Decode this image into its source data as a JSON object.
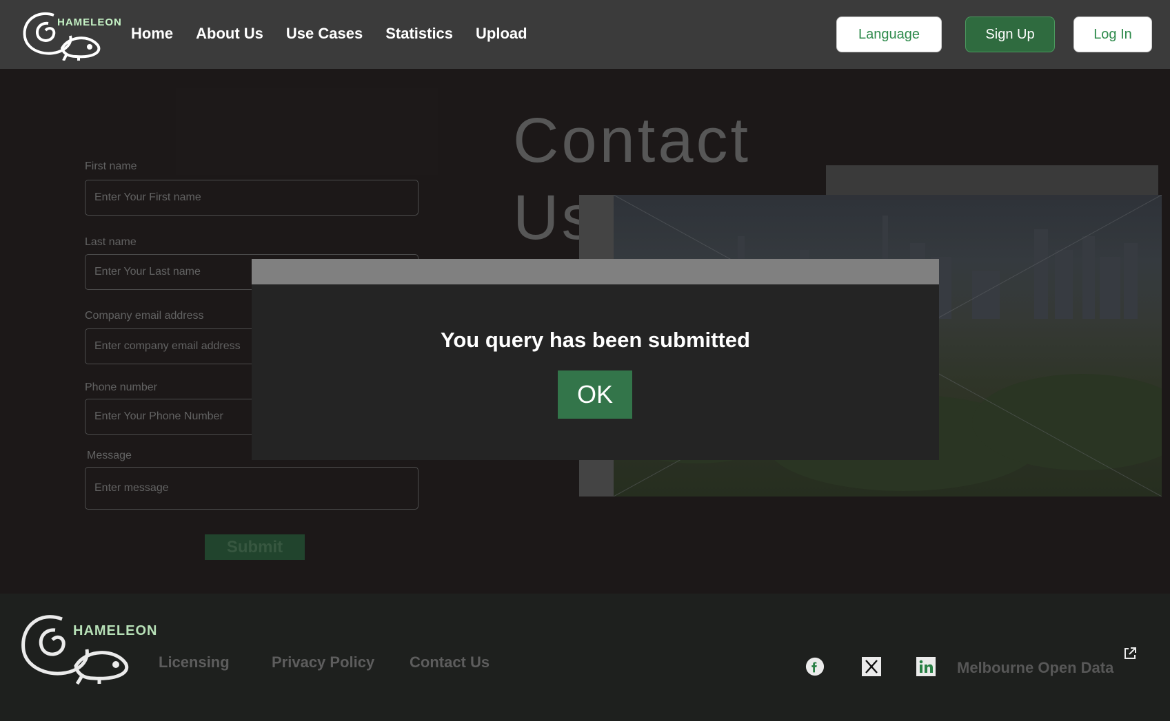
{
  "header": {
    "logo_text": "HAMELEON",
    "nav": [
      "Home",
      "About Us",
      "Use Cases",
      "Statistics",
      "Upload"
    ],
    "language_label": "Language",
    "signup_label": "Sign Up",
    "login_label": "Log In"
  },
  "contact": {
    "title_line1": "Contact",
    "title_line2": "Us"
  },
  "form": {
    "first_name_label": "First name",
    "first_name_placeholder": "Enter Your First name",
    "last_name_label": "Last name",
    "last_name_placeholder": "Enter Your Last name",
    "email_label": "Company email address",
    "email_placeholder": "Enter company email address",
    "phone_label": "Phone number",
    "phone_placeholder": "Enter Your Phone Number",
    "message_label": "Message",
    "message_placeholder": "Enter message",
    "submit_label": "Submit"
  },
  "modal": {
    "message": "You query has been submitted",
    "ok_label": "OK"
  },
  "footer": {
    "logo_text": "HAMELEON",
    "links": [
      "Licensing",
      "Privacy Policy",
      "Contact Us"
    ],
    "social_icons": [
      "facebook-icon",
      "x-icon",
      "linkedin-icon"
    ],
    "open_data_label": "Melbourne Open Data"
  },
  "colors": {
    "accent_green": "#2f6b3f",
    "ok_button": "#33754a",
    "logo_green": "#c7f4c7"
  }
}
